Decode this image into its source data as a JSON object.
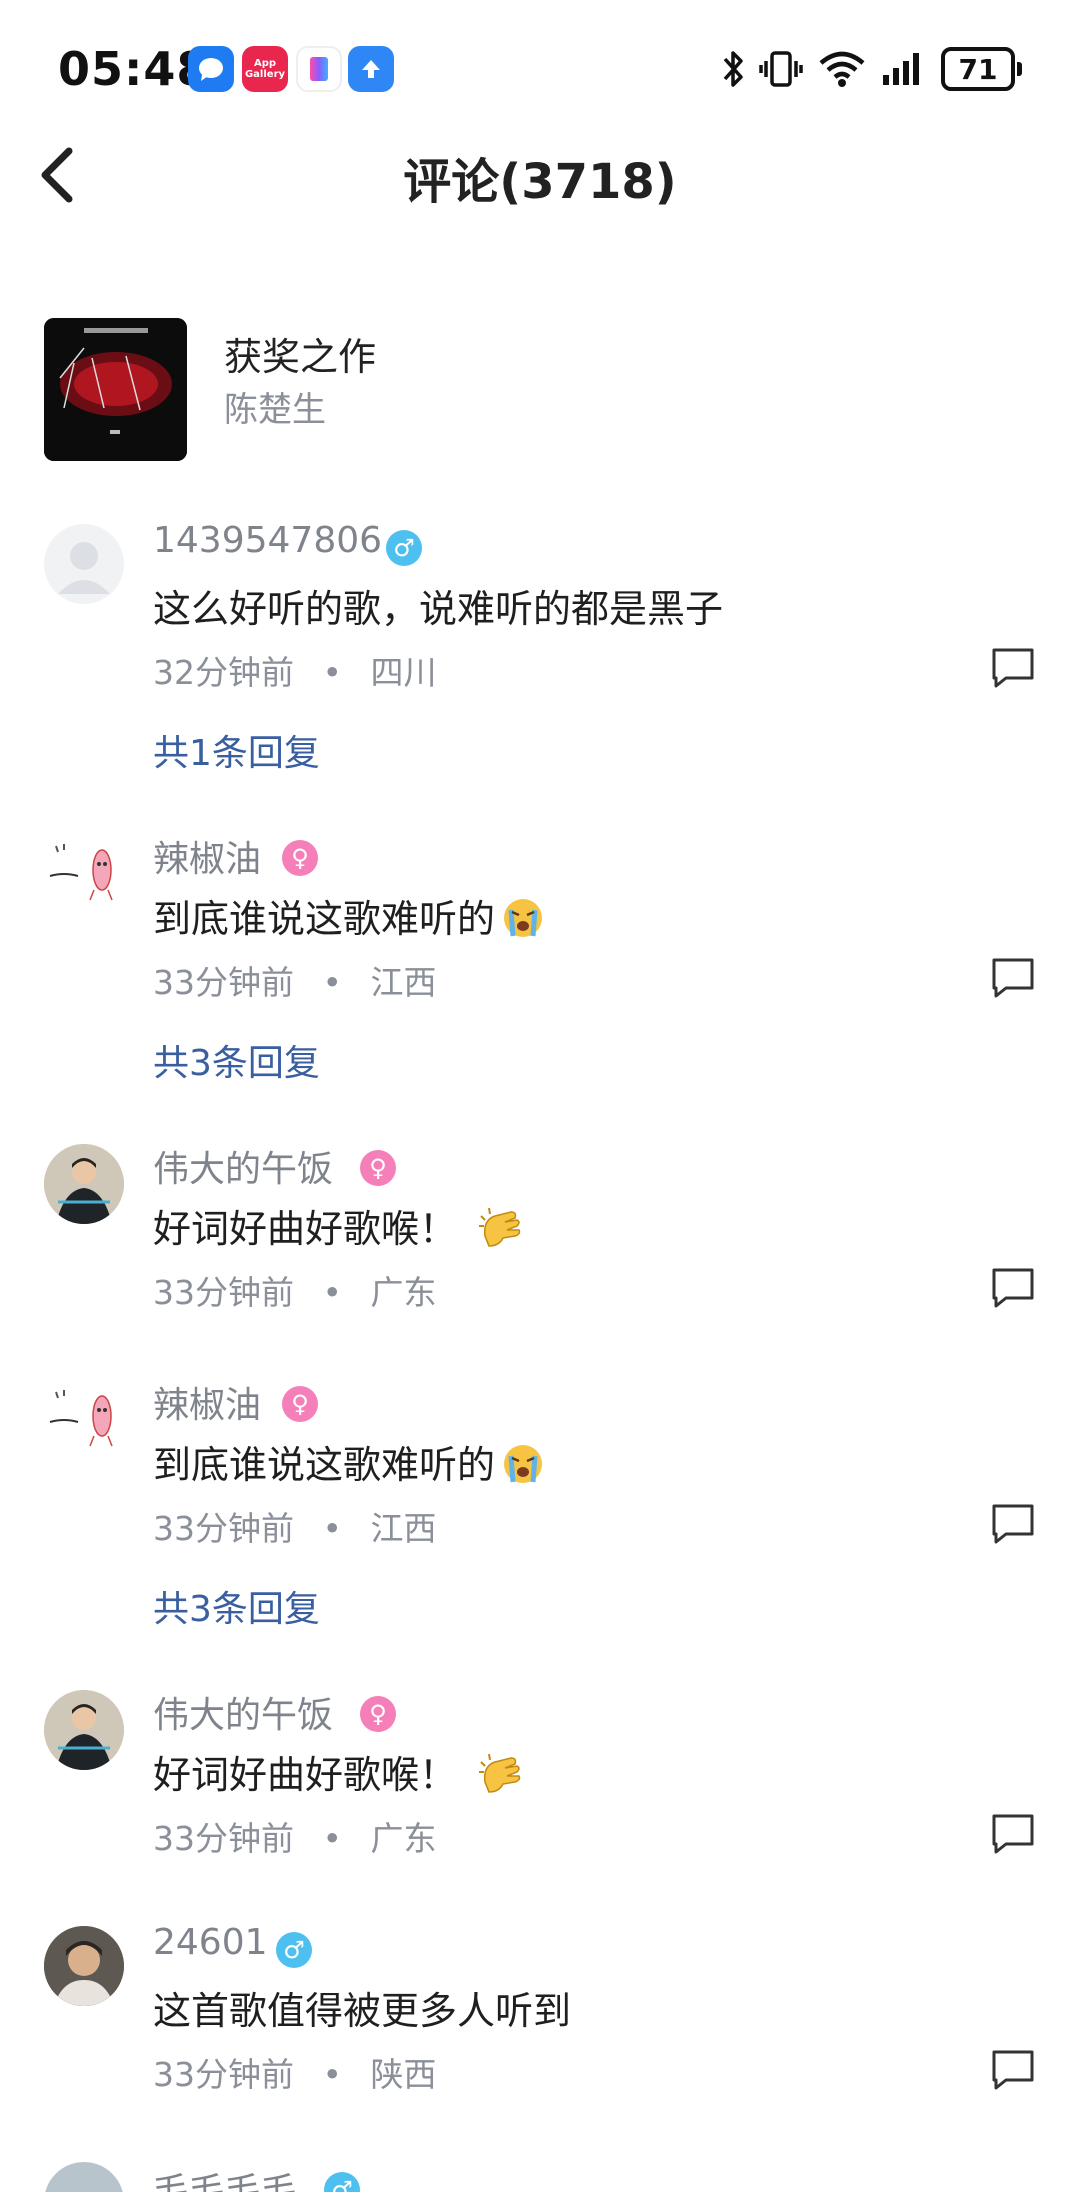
{
  "status_bar": {
    "time": "05:48",
    "notifications": [
      "message-icon",
      "app-gallery-icon",
      "theme-app-icon",
      "upload-icon"
    ],
    "app_gallery_text": "App Gallery",
    "battery": "71",
    "icons": [
      "bluetooth-icon",
      "vibrate-icon",
      "wifi-icon",
      "signal-icon",
      "battery-icon"
    ]
  },
  "header": {
    "title": "评论(3718)"
  },
  "song": {
    "title": "获奖之作",
    "artist": "陈楚生"
  },
  "comments": [
    {
      "user": "1439547806",
      "gender": "male",
      "text": "这么好听的歌，说难听的都是黑子",
      "time": "32分钟前",
      "location": "四川",
      "replies": "共1条回复"
    },
    {
      "user": "辣椒油",
      "gender": "female",
      "text": "到底谁说这歌难听的",
      "emoji": "crying-face",
      "time": "33分钟前",
      "location": "江西",
      "replies": "共3条回复"
    },
    {
      "user": "伟大的午饭",
      "gender": "female",
      "text": "好词好曲好歌喉！",
      "emoji": "clapping-hands",
      "time": "33分钟前",
      "location": "广东",
      "replies": ""
    },
    {
      "user": "辣椒油",
      "gender": "female",
      "text": "到底谁说这歌难听的",
      "emoji": "crying-face",
      "time": "33分钟前",
      "location": "江西",
      "replies": "共3条回复"
    },
    {
      "user": "伟大的午饭",
      "gender": "female",
      "text": "好词好曲好歌喉！",
      "emoji": "clapping-hands",
      "time": "33分钟前",
      "location": "广东",
      "replies": ""
    },
    {
      "user": "24601",
      "gender": "male",
      "text": "这首歌值得被更多人听到",
      "time": "33分钟前",
      "location": "陕西",
      "replies": ""
    },
    {
      "user": "毛毛毛毛",
      "gender": "male",
      "text": "",
      "time": "",
      "location": "",
      "replies": ""
    }
  ],
  "meta_separator": "•",
  "gender_symbols": {
    "male": "♂",
    "female": "♀"
  }
}
